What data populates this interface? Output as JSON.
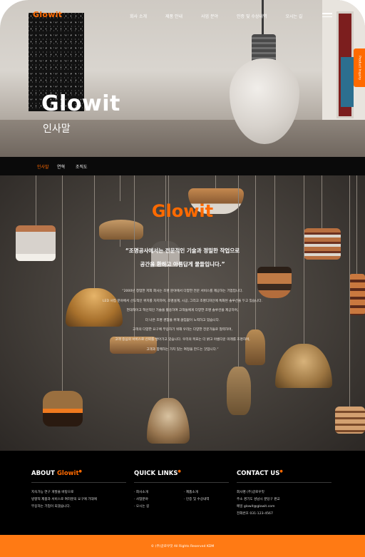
{
  "header": {
    "logo": "Glowit",
    "nav": [
      "회사 소개",
      "제품 안내",
      "사업 분야",
      "인증 및 수상내역",
      "오시는 길"
    ],
    "side_tab": "Product Inquiry"
  },
  "hero": {
    "title": "Glowit",
    "subtitle": "인사말"
  },
  "subnav": {
    "tabs": [
      "인사말",
      "연혁",
      "조직도"
    ],
    "active": "인사말"
  },
  "intro": {
    "logo": "Glowit",
    "quote": [
      "“조명공사에서는 전문적인 기술과 정밀한 작업으로",
      "공간을 환하고 아름답게 물들입니다.”"
    ],
    "body": [
      "“2000년 창업한 저희 회사는 조명 분야에서 다양한 전문 서비스를 제공하는 기업입니다.",
      "LED 사업 분야에서 선도적인 위치를 차지하며, 조명설계, 시공, 그리고 조명디자인에 특화된 솔루션을 두고 있습니다.",
      "현대적이고 혁신적인 기술을 활용하여 고객들에게 다양한 조명 솔루션을 제공하며,",
      "더 나은 조명 경험을 위해 끊임없이 노력하고 있습니다.",
      "고객의 다양한 요구에 부응하기 위해 우리는 다양한 전문가들로 협력하며,",
      "고객 중심의 서비스로 신뢰를 쌓아가고 있습니다. 우리의 목표는 더 밝고 아름다운 미래를 조명하며,",
      "고객과 함께하는 가치 있는 여정을 만드는 것입니다.”"
    ]
  },
  "footer": {
    "about": {
      "heading_prefix": "ABOUT",
      "heading_brand": "Glowit",
      "lines": [
        "지속가능 연구 개발을 바탕으로",
        "방향적 제품과 서비스로 여러분의 요구에 기대에",
        "부응하는 기업이 되겠습니다."
      ]
    },
    "quick_links": {
      "heading": "QUICK LINKS",
      "items": [
        "· 회사소개",
        "· 제품소개",
        "· 사업분야",
        "· 인증 및 수상내역",
        "· 오시는 길"
      ]
    },
    "contact": {
      "heading": "CONTACT US",
      "lines": [
        "회사명 (주)글로우잇",
        "주소 경기도 성남시 분당구 판교",
        "메일 glowit@glowit.com",
        "전화번호 031-123-4567"
      ]
    },
    "copyright": "© (주)글로우잇 All Rights Reserved KDM"
  },
  "colors": {
    "accent": "#ff6a00",
    "footer_bar": "#ff7a14",
    "footer_bg": "#000000",
    "subnav_bg": "#0a0a0a"
  }
}
